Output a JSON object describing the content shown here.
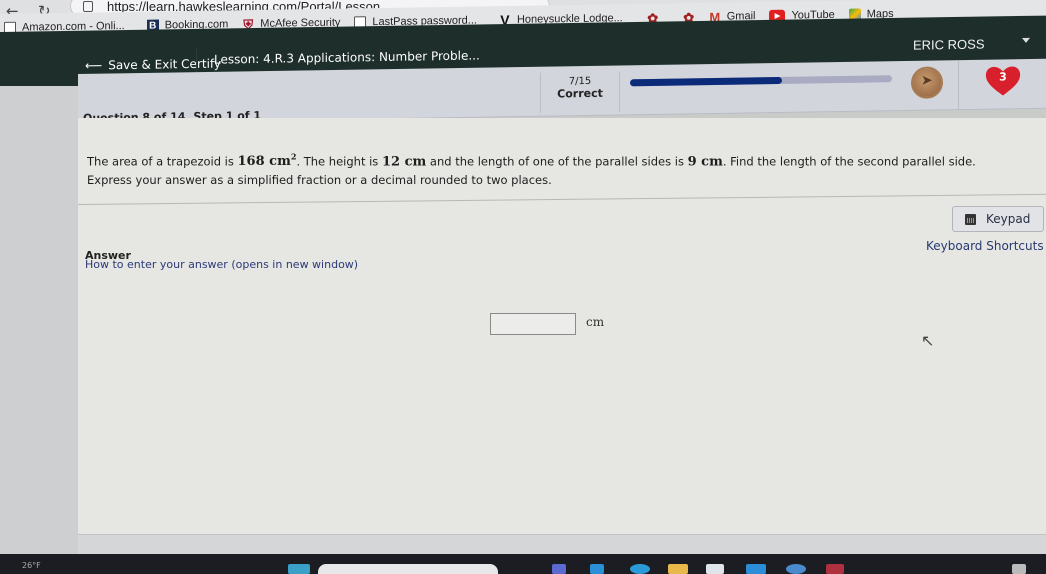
{
  "browser": {
    "url": "https://learn.hawkeslearning.com/Portal/Lesson",
    "back_icon": "arrow-left-icon",
    "reload_icon": "reload-icon",
    "bookmarks": [
      {
        "label": "Amazon.com - Onli...",
        "icon": "document-icon"
      },
      {
        "label": "Booking.com",
        "icon": "booking-b-icon"
      },
      {
        "label": "McAfee Security",
        "icon": "mcafee-shield-icon"
      },
      {
        "label": "LastPass password...",
        "icon": "document-icon"
      },
      {
        "label": "Honeysuckle Lodge...",
        "icon": "v-logo-icon"
      },
      {
        "label": "",
        "icon": "bird-icon"
      },
      {
        "label": "",
        "icon": "bird-icon"
      },
      {
        "label": "Gmail",
        "icon": "gmail-icon"
      },
      {
        "label": "YouTube",
        "icon": "youtube-icon"
      },
      {
        "label": "Maps",
        "icon": "maps-icon"
      }
    ]
  },
  "header": {
    "user_name": "ERIC ROSS",
    "save_exit_label": "Save & Exit Certify",
    "lesson_title": "Lesson: 4.R.3 Applications: Number Proble..."
  },
  "status": {
    "question_label": "Question 8 of 14, Step 1 of 1",
    "score_fraction": "7/15",
    "score_label": "Correct",
    "progress_fraction": 0.58,
    "lives": "3",
    "colors": {
      "progress_fill": "#0c2a7a",
      "progress_track": "#a8abc2",
      "heart": "#d8202c"
    }
  },
  "question": {
    "text_1": "The area of a trapezoid is ",
    "area_value": "168 cm",
    "area_exp": "2",
    "text_2": ". The height is ",
    "height_value": "12 cm",
    "text_3": " and the length of one of the parallel sides is ",
    "side_value": "9 cm",
    "text_4": ". Find the length of the second parallel side.  Express your answer as a simplified fraction or a decimal rounded to two places."
  },
  "answer": {
    "label": "Answer",
    "howto_link": "How to enter your answer (opens in new window)",
    "keypad_label": "Keypad",
    "shortcuts_label": "Keyboard Shortcuts",
    "input_value": "",
    "unit": "cm"
  },
  "taskbar": {
    "weather": "26°F"
  }
}
